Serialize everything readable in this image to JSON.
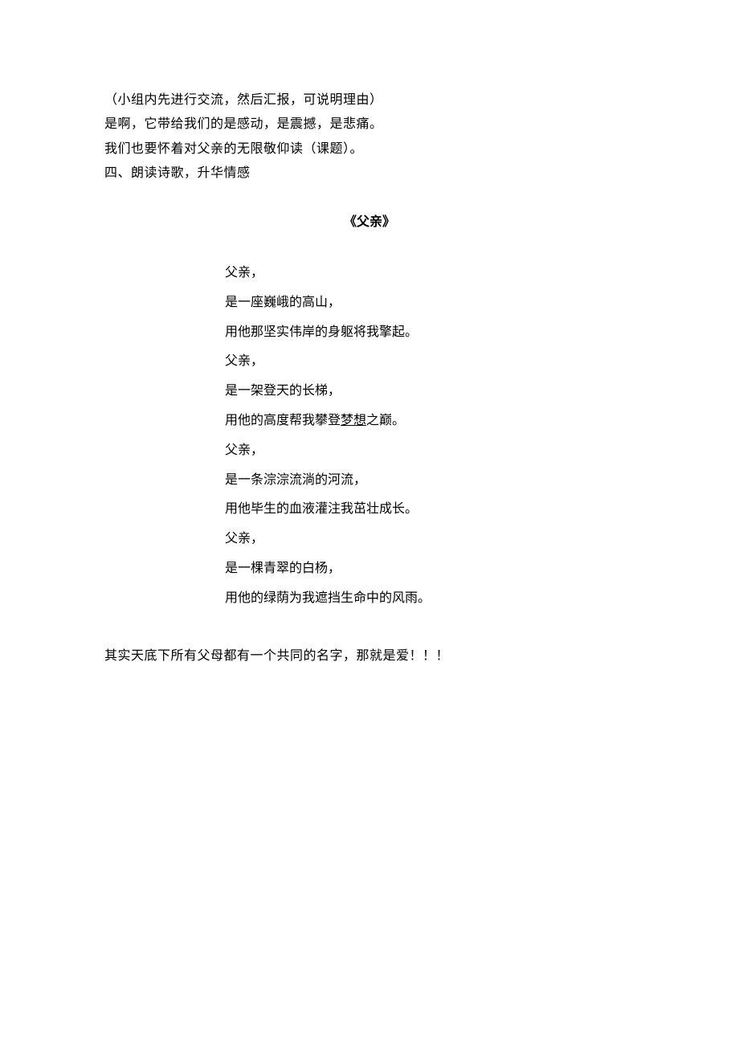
{
  "intro": {
    "line1": "（小组内先进行交流，然后汇报，可说明理由）",
    "line2": "是啊，它带给我们的是感动，是震撼，是悲痛。",
    "line3": "我们也要怀着对父亲的无限敬仰读（课题）。",
    "line4": "四、朗读诗歌，升华情感"
  },
  "poem": {
    "title": "《父亲》",
    "stanzas": [
      {
        "l1": "父亲，",
        "l2": "是一座巍峨的高山，",
        "l3": "用他那坚实伟岸的身躯将我擎起。"
      },
      {
        "l1": "父亲，",
        "l2": "是一架登天的长梯，",
        "l3_pre": "用他的高度帮我攀登",
        "l3_ul": "梦想",
        "l3_post": "之巅。"
      },
      {
        "l1": "父亲，",
        "l2": "是一条淙淙流淌的河流，",
        "l3": "用他毕生的血液灌注我茁壮成长。"
      },
      {
        "l1": "父亲，",
        "l2": "是一棵青翠的白杨，",
        "l3": "用他的绿荫为我遮挡生命中的风雨。"
      }
    ]
  },
  "closing": "其实天底下所有父母都有一个共同的名字，那就是爱！！！"
}
